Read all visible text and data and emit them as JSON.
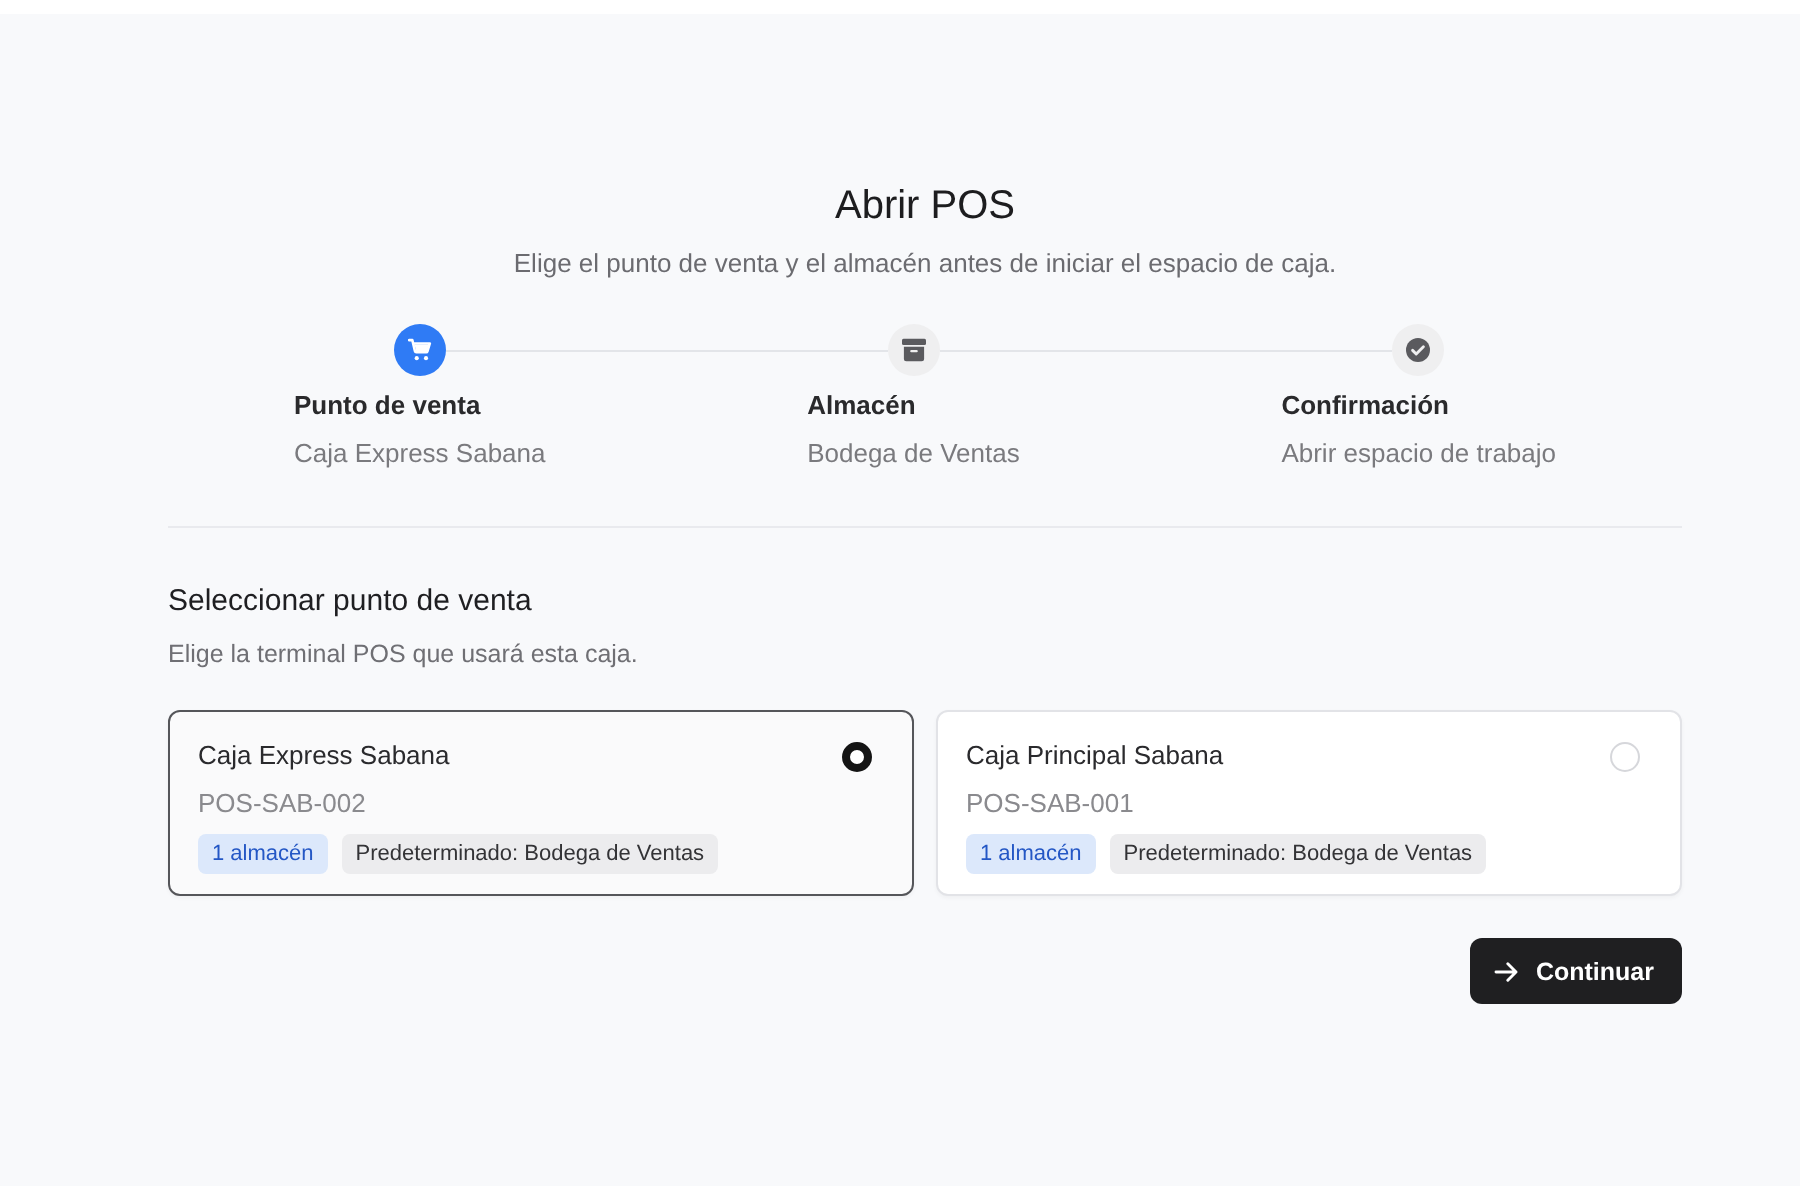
{
  "header": {
    "title": "Abrir POS",
    "subtitle": "Elige el punto de venta y el almacén antes de iniciar el espacio de caja."
  },
  "steps": [
    {
      "kind": "sale",
      "title": "Punto de venta",
      "value": "Caja Express Sabana",
      "active": true
    },
    {
      "kind": "warehouse",
      "title": "Almacén",
      "value": "Bodega de Ventas",
      "active": false
    },
    {
      "kind": "confirm",
      "title": "Confirmación",
      "value": "Abrir espacio de trabajo",
      "active": false
    }
  ],
  "section": {
    "title": "Seleccionar punto de venta",
    "description": "Elige la terminal POS que usará esta caja."
  },
  "terminals": [
    {
      "name": "Caja Express Sabana",
      "code": "POS-SAB-002",
      "selected": true,
      "badges": [
        {
          "kind": "info",
          "label": "1 almacén"
        },
        {
          "kind": "neutral",
          "label": "Predeterminado: Bodega de Ventas"
        }
      ]
    },
    {
      "name": "Caja Principal Sabana",
      "code": "POS-SAB-001",
      "selected": false,
      "badges": [
        {
          "kind": "info",
          "label": "1 almacén"
        },
        {
          "kind": "neutral",
          "label": "Predeterminado: Bodega de Ventas"
        }
      ]
    }
  ],
  "continue_button": {
    "label": "Continuar"
  }
}
